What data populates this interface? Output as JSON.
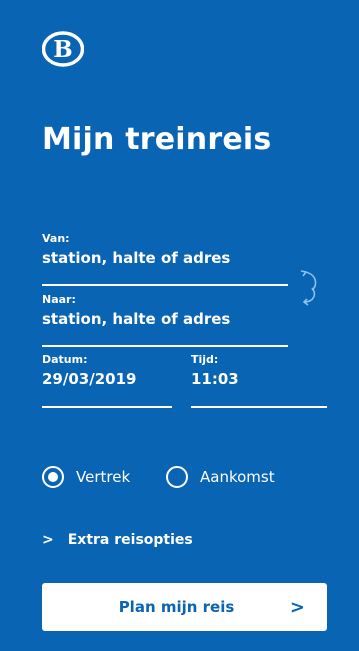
{
  "brand": {
    "logo_letter": "B",
    "logo_icon": "nmbs-logo-icon",
    "color_bg": "#0a64b4",
    "color_fg": "#ffffff"
  },
  "page_title": "Mijn treinreis",
  "from": {
    "label": "Van:",
    "value": "station, halte of adres"
  },
  "to": {
    "label": "Naar:",
    "value": "station, halte of adres"
  },
  "swap_icon": "swap-arrows-icon",
  "date": {
    "label": "Datum:",
    "value": "29/03/2019"
  },
  "time": {
    "label": "Tijd:",
    "value": "11:03"
  },
  "mode": {
    "options": [
      {
        "label": "Vertrek",
        "selected": true
      },
      {
        "label": "Aankomst",
        "selected": false
      }
    ]
  },
  "extra_options": {
    "label": "Extra reisopties",
    "icon": "chevron-right-icon"
  },
  "plan_button": {
    "label": "Plan mijn reis",
    "icon": "chevron-right-icon"
  }
}
